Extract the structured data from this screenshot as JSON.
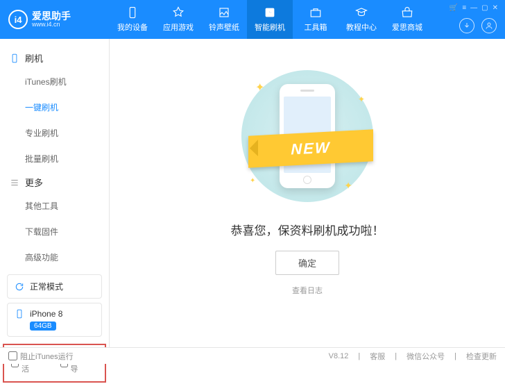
{
  "logo": {
    "title": "爱思助手",
    "sub": "www.i4.cn",
    "mark": "i4"
  },
  "nav": [
    {
      "label": "我的设备"
    },
    {
      "label": "应用游戏"
    },
    {
      "label": "铃声壁纸"
    },
    {
      "label": "智能刷机",
      "active": true
    },
    {
      "label": "工具箱"
    },
    {
      "label": "教程中心"
    },
    {
      "label": "爱思商城"
    }
  ],
  "sidebar": {
    "group1": {
      "title": "刷机",
      "items": [
        "iTunes刷机",
        "一键刷机",
        "专业刷机",
        "批量刷机"
      ],
      "activeIndex": 1
    },
    "group2": {
      "title": "更多",
      "items": [
        "其他工具",
        "下载固件",
        "高级功能"
      ]
    }
  },
  "mode": {
    "label": "正常模式"
  },
  "device": {
    "name": "iPhone 8",
    "badge": "64GB"
  },
  "bottomChecks": {
    "c1": "自动激活",
    "c2": "跳过向导"
  },
  "main": {
    "ribbon": "NEW",
    "successText": "恭喜您，保资料刷机成功啦！",
    "okBtn": "确定",
    "logLink": "查看日志"
  },
  "footer": {
    "blockItunes": "阻止iTunes运行",
    "version": "V8.12",
    "service": "客服",
    "wechat": "微信公众号",
    "update": "检查更新"
  }
}
